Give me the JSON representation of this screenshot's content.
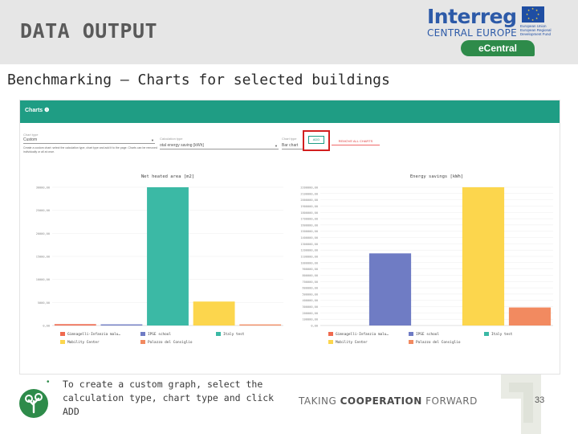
{
  "slide": {
    "title": "DATA OUTPUT",
    "subtitle": "Benchmarking – Charts for selected buildings",
    "instruction": "To create a custom graph, select the calculation type, chart type and click ADD",
    "bullet": "•",
    "tagline_part1": "TAKING ",
    "tagline_bold": "COOPERATION",
    "tagline_part2": " FORWARD",
    "page_number": "33"
  },
  "logo": {
    "name": "Interreg",
    "region": "CENTRAL EUROPE",
    "eu_text": "European Union European Regional Development Fund",
    "project": "eCentral"
  },
  "app": {
    "bar_title": "Charts ❶",
    "controls": {
      "chart_label": "Chart type",
      "chart_value": "Custom",
      "calc_label": "Calculation type",
      "calc_value": "otal energy saving [kWh]",
      "type_label": "Chart type",
      "type_value": "Bar chart",
      "add_label": "ADD",
      "remove_label": "REMOVE ALL CHARTS",
      "note": "Create a custom chart: select the calculation type, chart type and add it to the page. Charts can be removed individually or all at once."
    }
  },
  "colors": {
    "header_band": "#e6e6e6",
    "app_bar": "#1f9d84",
    "brand_blue": "#2d5aa8",
    "brand_green": "#2e8b4a",
    "highlight": "#d21f1f"
  },
  "chart_data": [
    {
      "type": "bar",
      "title": "Net heated area [m2]",
      "categories": [
        "Gimnagelli-Infanzia malu…",
        "IPSE school",
        "Italy test",
        "Mobility Center",
        "Palazzo del Consiglio"
      ],
      "series": [
        {
          "values": [
            290,
            240,
            30000,
            5200,
            230
          ]
        }
      ],
      "ylim": [
        0,
        30000
      ],
      "yticks": [
        "0,00",
        "5000,00",
        "10000,00",
        "15000,00",
        "20000,00",
        "25000,00",
        "30000,00"
      ],
      "legend_placement": "bottom"
    },
    {
      "type": "bar",
      "title": "Energy savings [kWh]",
      "categories": [
        "Gimnagelli-Infanzia malu…",
        "IPSE school",
        "Italy test",
        "Mobility Center",
        "Palazzo del Consiglio"
      ],
      "series": [
        {
          "values": [
            0,
            1200000,
            0,
            2300000,
            300000
          ]
        }
      ],
      "ylim": [
        0,
        2300000
      ],
      "yticks": [
        "0,00",
        "100000,00",
        "200000,00",
        "300000,00",
        "400000,00",
        "500000,00",
        "600000,00",
        "700000,00",
        "800000,00",
        "900000,00",
        "1000000,00",
        "1100000,00",
        "1200000,00",
        "1300000,00",
        "1400000,00",
        "1500000,00",
        "1600000,00",
        "1700000,00",
        "1800000,00",
        "1900000,00",
        "2000000,00",
        "2100000,00",
        "2200000,00"
      ],
      "legend_placement": "bottom"
    }
  ],
  "series_colors": [
    "#ef6a4f",
    "#6f7cc4",
    "#3bb9a5",
    "#fcd64d",
    "#f28a60"
  ]
}
